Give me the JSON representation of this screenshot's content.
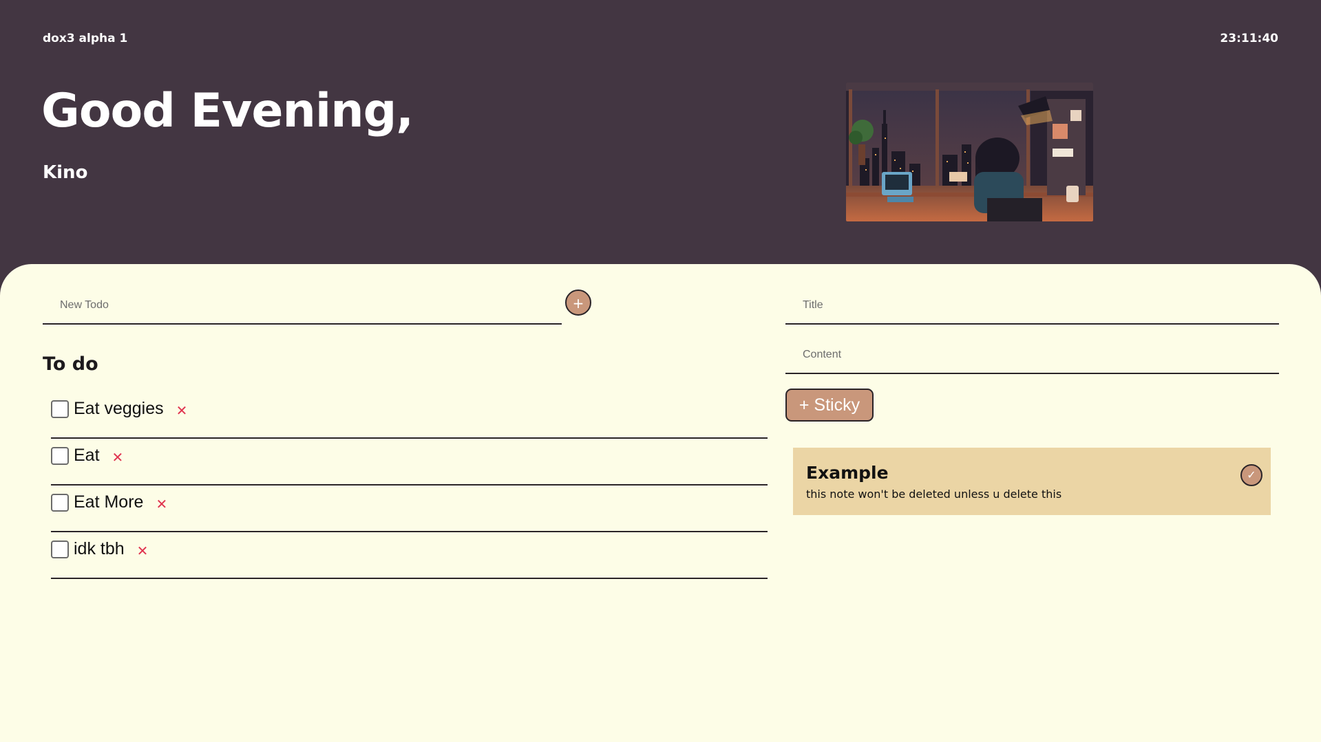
{
  "header": {
    "app_title": "dox3 alpha 1",
    "clock": "23:11:40",
    "greeting": "Good Evening,",
    "username": "Kino"
  },
  "todo": {
    "input_placeholder": "New Todo",
    "add_button_label": "+",
    "heading": "To do",
    "items": [
      {
        "text": "Eat veggies",
        "checked": false
      },
      {
        "text": "Eat",
        "checked": false
      },
      {
        "text": "Eat More",
        "checked": false
      },
      {
        "text": "idk tbh",
        "checked": false
      }
    ],
    "delete_glyph": "✕"
  },
  "notes": {
    "title_placeholder": "Title",
    "content_placeholder": "Content",
    "add_button_label": "+ Sticky",
    "stickies": [
      {
        "title": "Example",
        "body": "this note won't be deleted unless u delete this",
        "done_glyph": "✓"
      }
    ]
  },
  "colors": {
    "header_bg": "#433642",
    "panel_bg": "#fdfde7",
    "accent": "#c9977b",
    "sticky_bg": "#ebd5a5",
    "delete": "#e0344f"
  }
}
